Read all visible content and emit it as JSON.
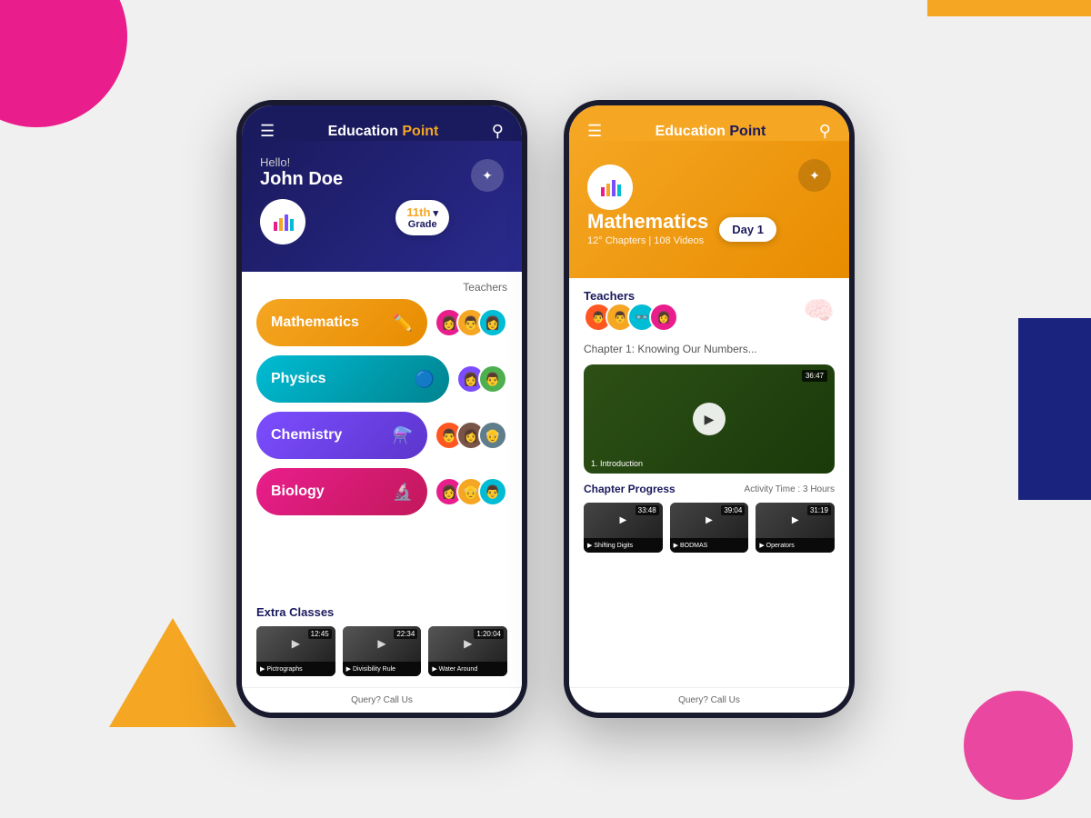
{
  "background": {
    "accent_color": "#f5a623",
    "pink_color": "#e91e8c",
    "blue_color": "#1a237e"
  },
  "phone1": {
    "header": {
      "title_bold": "Education",
      "title_normal": " Point",
      "menu_icon": "☰",
      "search_icon": "🔍"
    },
    "hero": {
      "greeting": "Hello!",
      "user_name": "John Doe",
      "grade": "11th",
      "grade_sub": "Grade"
    },
    "subjects_header": "Teachers",
    "subjects": [
      {
        "name": "Mathematics",
        "color_class": "math",
        "icon": "✏️"
      },
      {
        "name": "Physics",
        "color_class": "physics",
        "icon": "🔵"
      },
      {
        "name": "Chemistry",
        "color_class": "chemistry",
        "icon": "⚗️"
      },
      {
        "name": "Biology",
        "color_class": "biology",
        "icon": "🔬"
      }
    ],
    "extra_classes": {
      "title": "Extra Classes",
      "videos": [
        {
          "label": "▶ Pictrographs",
          "duration": "12:45"
        },
        {
          "label": "▶ Divisibility Rule",
          "duration": "22:34"
        },
        {
          "label": "▶ Water Around",
          "duration": "1:20:04"
        }
      ]
    },
    "footer": "Query? Call Us"
  },
  "phone2": {
    "header": {
      "title_bold": "Education",
      "title_normal": " Point",
      "menu_icon": "☰",
      "search_icon": "🔍"
    },
    "hero": {
      "subject": "Mathematics",
      "chapters": "12",
      "videos": "108",
      "meta": "12° Chapters | 108 Videos",
      "day": "Day 1"
    },
    "teachers_label": "Teachers",
    "chapter": {
      "label": "Chapter 1",
      "title": ": Knowing Our Numbers..."
    },
    "main_video": {
      "title": "1. Introduction",
      "duration": "36:47"
    },
    "chapter_progress": {
      "label": "Chapter Progress",
      "activity": "Activity Time : 3 Hours",
      "videos": [
        {
          "label": "▶ Shifting Digits",
          "duration": "33:48"
        },
        {
          "label": "▶ BODMAS",
          "duration": "39:04"
        },
        {
          "label": "▶ Operators",
          "duration": "31:19"
        }
      ]
    },
    "footer": "Query? Call Us"
  }
}
